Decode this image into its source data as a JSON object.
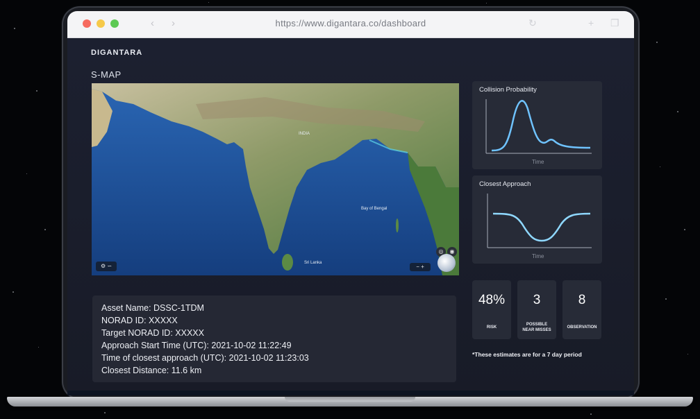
{
  "browser": {
    "url": "https://www.digantara.co/dashboard"
  },
  "app": {
    "brand": "DIGANTARA",
    "map_title": "S-MAP"
  },
  "map": {
    "labels": [
      "INDIA",
      "Bay of Bengal",
      "Sri Lanka"
    ]
  },
  "asset": {
    "lines": [
      "Asset Name: DSSC-1TDM",
      "NORAD ID: XXXXX",
      "Target NORAD ID: XXXXX",
      "Approach Start Time (UTC): 2021-10-02 11:22:49",
      "Time of closest approach (UTC): 2021-10-02 11:23:03",
      "Closest Distance: 11.6 km"
    ]
  },
  "collision_panel": {
    "title": "Collision Probability",
    "x_label": "Time"
  },
  "approach_panel": {
    "title": "Closest Approach",
    "x_label": "Time"
  },
  "stats": [
    {
      "value": "48%",
      "label": "RISK"
    },
    {
      "value": "3",
      "label": "POSSIBLE\nNEAR MISSES"
    },
    {
      "value": "8",
      "label": "OBSERVATION"
    }
  ],
  "note": "*These estimates are for a 7 day period",
  "colors": {
    "accent_curve": "#6fc3ff",
    "panel_bg": "#272b37",
    "app_bg": "#1c2030"
  }
}
